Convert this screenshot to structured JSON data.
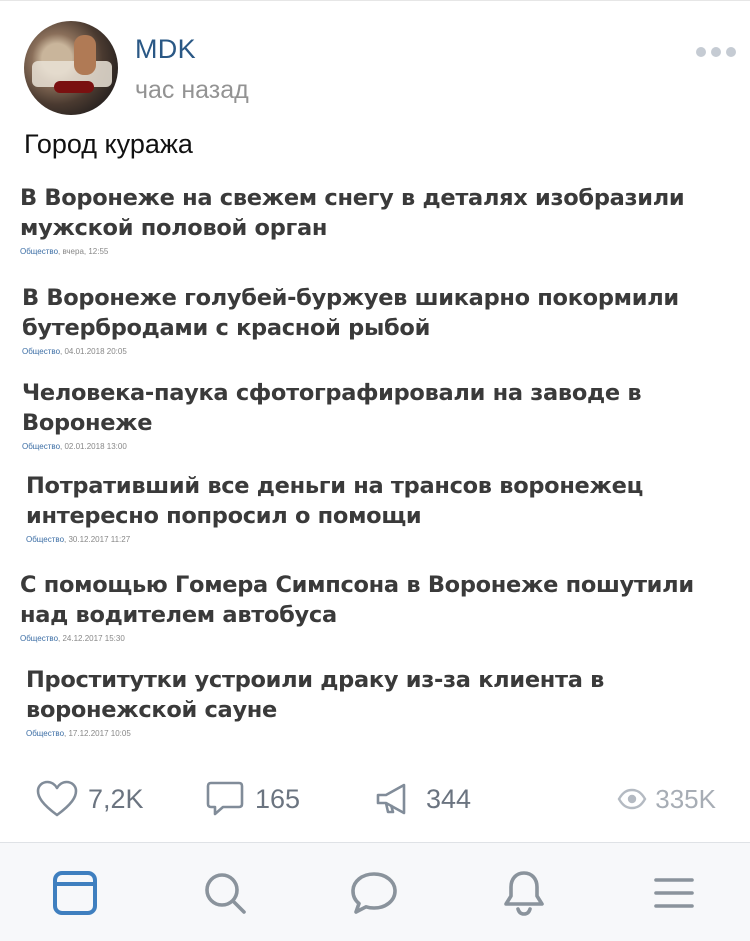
{
  "post": {
    "author": "MDK",
    "time": "час назад",
    "text": "Город куража"
  },
  "news": [
    {
      "title_line1": "В Воронеже на свежем снегу в деталях изобразили",
      "title_line2": "мужской половой орган",
      "category": "Общество",
      "date": "вчера, 12:55"
    },
    {
      "title_line1": "В Воронеже голубей-буржуев шикарно покормили",
      "title_line2": "бутербродами с красной рыбой",
      "category": "Общество",
      "date": "04.01.2018 20:05"
    },
    {
      "title_line1": "Человека-паука сфотографировали на заводе в",
      "title_line2": "Воронеже",
      "category": "Общество",
      "date": "02.01.2018 13:00"
    },
    {
      "title_line1": "Потративший все деньги на трансов воронежец",
      "title_line2": "интересно попросил о помощи",
      "category": "Общество",
      "date": "30.12.2017 11:27"
    },
    {
      "title_line1": "С помощью Гомера Симпсона в Воронеже пошутили",
      "title_line2": "над водителем автобуса",
      "category": "Общество",
      "date": "24.12.2017 15:30"
    },
    {
      "title_line1": "Проститутки устроили драку из-за клиента в",
      "title_line2": "воронежской сауне",
      "category": "Общество",
      "date": "17.12.2017 10:05"
    }
  ],
  "actions": {
    "likes": "7,2K",
    "comments": "165",
    "reposts": "344",
    "views": "335K"
  },
  "tabbar": {
    "items": [
      "news-icon",
      "search-icon",
      "messages-icon",
      "notifications-icon",
      "menu-icon"
    ],
    "active_color": "#3f7fbf",
    "inactive_color": "#8a939c"
  }
}
